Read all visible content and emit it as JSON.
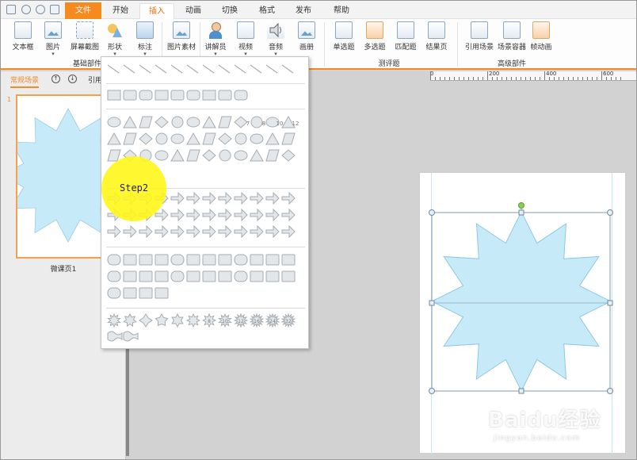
{
  "tabs": {
    "file": "文件",
    "start": "开始",
    "insert": "插入",
    "animation": "动画",
    "transition": "切换",
    "format": "格式",
    "publish": "发布",
    "help": "帮助"
  },
  "ribbon": {
    "text_box": "文本框",
    "picture": "图片",
    "screenshot": "屏幕截图",
    "shape": "形状",
    "annotation": "标注",
    "picture_material": "图片素材",
    "presenter": "讲解员",
    "video": "视频",
    "audio": "音频",
    "album": "画册",
    "single_choice": "单选题",
    "multi_choice": "多选题",
    "matching": "匹配题",
    "result_page": "结果页",
    "ref_scene": "引用场景",
    "scene_container": "场景容器",
    "frame_animation": "帧动画",
    "group_basic": "基础部件",
    "group_quiz": "测评题",
    "group_advanced": "高级部件"
  },
  "left_panel": {
    "scene_tab": "常规场景",
    "ref_label": "引用",
    "slide_number": "1",
    "slide_name": "微课页1"
  },
  "ruler": {
    "labels": [
      "0",
      "200",
      "400",
      "600"
    ]
  },
  "step_label": "Step2",
  "watermark": {
    "brand": "Baidu经验",
    "url": "jingyan.baidu.com"
  },
  "colors": {
    "accent": "#f58a1f",
    "star_fill": "#c6eaf8",
    "step_marker": "#fff714"
  },
  "shape_menu": {
    "badge_numbers": [
      "7",
      "8",
      "10",
      "12",
      "8",
      "10",
      "12",
      "16",
      "24",
      "32"
    ]
  }
}
